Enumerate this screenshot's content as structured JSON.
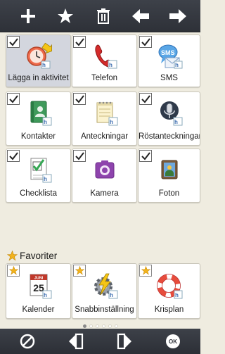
{
  "toolbar": {
    "icons": [
      "plus-icon",
      "star-icon",
      "trash-icon",
      "arrow-left-icon",
      "arrow-right-icon"
    ]
  },
  "tiles": [
    {
      "label": "Lägga in aktivitet",
      "icon": "clock-add-icon",
      "checked": true,
      "selected": true
    },
    {
      "label": "Telefon",
      "icon": "phone-icon",
      "checked": true,
      "selected": false
    },
    {
      "label": "SMS",
      "icon": "sms-icon",
      "checked": true,
      "selected": false
    },
    {
      "label": "Kontakter",
      "icon": "contacts-book-icon",
      "checked": true,
      "selected": false
    },
    {
      "label": "Anteckningar",
      "icon": "notepad-icon",
      "checked": true,
      "selected": false
    },
    {
      "label": "Röstanteckningar",
      "icon": "microphone-icon",
      "checked": true,
      "selected": false
    },
    {
      "label": "Checklista",
      "icon": "checklist-icon",
      "checked": true,
      "selected": false
    },
    {
      "label": "Kamera",
      "icon": "camera-icon",
      "checked": true,
      "selected": false
    },
    {
      "label": "Foton",
      "icon": "photos-icon",
      "checked": true,
      "selected": false
    }
  ],
  "favorites": {
    "title": "Favoriter",
    "items": [
      {
        "label": "Kalender",
        "icon": "calendar-icon",
        "calendar_month": "JUNI",
        "calendar_day": "25"
      },
      {
        "label": "Snabbinställning",
        "icon": "lightning-gear-icon"
      },
      {
        "label": "Krisplan",
        "icon": "lifebuoy-icon"
      }
    ]
  },
  "pager": {
    "pages": 6,
    "active_index": 0
  },
  "bottom_bar": {
    "icons": [
      "cancel-icon",
      "move-left-icon",
      "move-right-icon",
      "ok-icon"
    ],
    "ok_text": "OK"
  },
  "colors": {
    "toolbar": "#33363d",
    "background": "#efece0",
    "accent_star": "#f2b31c",
    "selected_tile": "#d3d6de"
  }
}
